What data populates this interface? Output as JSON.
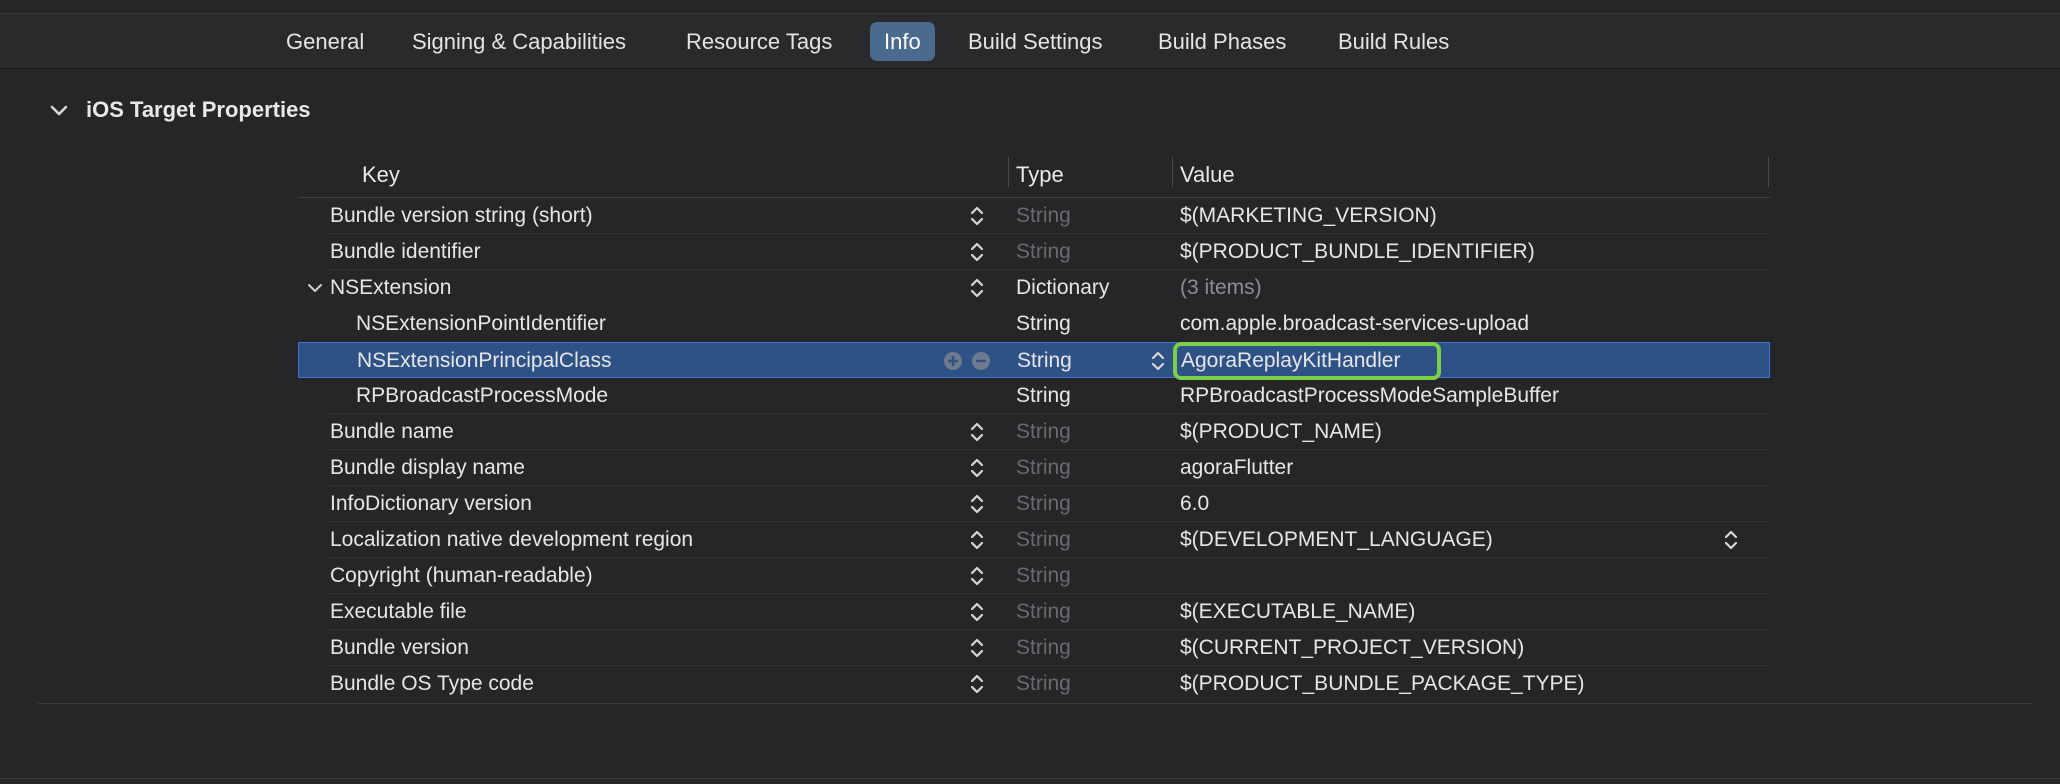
{
  "tabs": [
    {
      "label": "General"
    },
    {
      "label": "Signing & Capabilities"
    },
    {
      "label": "Resource Tags"
    },
    {
      "label": "Info"
    },
    {
      "label": "Build Settings"
    },
    {
      "label": "Build Phases"
    },
    {
      "label": "Build Rules"
    }
  ],
  "active_tab": "Info",
  "section": {
    "title": "iOS Target Properties"
  },
  "columns": {
    "key": "Key",
    "type": "Type",
    "value": "Value"
  },
  "rows": [
    {
      "key": "Bundle version string (short)",
      "type": "String",
      "value": "$(MARKETING_VERSION)"
    },
    {
      "key": "Bundle identifier",
      "type": "String",
      "value": "$(PRODUCT_BUNDLE_IDENTIFIER)"
    },
    {
      "key": "NSExtension",
      "type": "Dictionary",
      "value": "(3 items)"
    },
    {
      "key": "NSExtensionPointIdentifier",
      "type": "String",
      "value": "com.apple.broadcast-services-upload"
    },
    {
      "key": "NSExtensionPrincipalClass",
      "type": "String",
      "value": "AgoraReplayKitHandler"
    },
    {
      "key": "RPBroadcastProcessMode",
      "type": "String",
      "value": "RPBroadcastProcessModeSampleBuffer"
    },
    {
      "key": "Bundle name",
      "type": "String",
      "value": "$(PRODUCT_NAME)"
    },
    {
      "key": "Bundle display name",
      "type": "String",
      "value": "agoraFlutter"
    },
    {
      "key": "InfoDictionary version",
      "type": "String",
      "value": "6.0"
    },
    {
      "key": "Localization native development region",
      "type": "String",
      "value": "$(DEVELOPMENT_LANGUAGE)"
    },
    {
      "key": "Copyright (human-readable)",
      "type": "String",
      "value": ""
    },
    {
      "key": "Executable file",
      "type": "String",
      "value": "$(EXECUTABLE_NAME)"
    },
    {
      "key": "Bundle version",
      "type": "String",
      "value": "$(CURRENT_PROJECT_VERSION)"
    },
    {
      "key": "Bundle OS Type code",
      "type": "String",
      "value": "$(PRODUCT_BUNDLE_PACKAGE_TYPE)"
    }
  ],
  "colors": {
    "background": "#262628",
    "selection": "#2f5286",
    "active_tab": "#4a6a8e",
    "highlight_outline": "#7cd047",
    "dim_text": "#6a6a6e"
  }
}
